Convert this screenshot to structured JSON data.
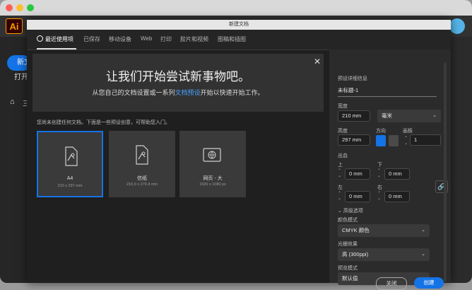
{
  "app": {
    "logo": "Ai"
  },
  "sidebar": {
    "new_label": "新文",
    "open_label": "打开",
    "home_label": "三"
  },
  "dialog": {
    "title": "新建文档",
    "tabs": [
      {
        "label": "最近使用项",
        "active": true
      },
      {
        "label": "已保存"
      },
      {
        "label": "移动设备"
      },
      {
        "label": "Web"
      },
      {
        "label": "打印"
      },
      {
        "label": "胶片和视频"
      },
      {
        "label": "图稿和插图"
      }
    ],
    "hero": {
      "title": "让我们开始尝试新事物吧。",
      "sub_before": "从您自己的文档设置或一系列",
      "sub_link": "文档预设",
      "sub_after": "开始以快速开始工作。"
    },
    "hint": "您尚未创建任何文档。下面是一些预设创意，可帮助您入门。",
    "presets": [
      {
        "name": "A4",
        "size": "210 x 297 mm",
        "selected": true
      },
      {
        "name": "信纸",
        "size": "215.9 x 279.4 mm"
      },
      {
        "name": "网页 - 大",
        "size": "1920 x 1080 px"
      }
    ]
  },
  "details": {
    "section_title": "预设详细信息",
    "doc_name": "未标题-1",
    "width_label": "宽度",
    "width_value": "210 mm",
    "unit_value": "毫米",
    "height_label": "高度",
    "height_value": "297 mm",
    "orientation_label": "方向",
    "artboards_label": "画板",
    "artboards_value": "1",
    "bleed_label": "出血",
    "top_label": "上",
    "top_value": "0 mm",
    "bottom_label": "下",
    "bottom_value": "0 mm",
    "left_label": "左",
    "left_value": "0 mm",
    "right_label": "右",
    "right_value": "0 mm",
    "advanced_label": "高级选项",
    "color_mode_label": "颜色模式",
    "color_mode_value": "CMYK 颜色",
    "raster_label": "光栅效果",
    "raster_value": "高 (300ppi)",
    "preview_label": "预览模式",
    "preview_value": "默认值"
  },
  "buttons": {
    "close": "关闭",
    "create": "创建"
  },
  "colors": {
    "accent": "#1473e6",
    "ai_orange": "#ff9a00"
  }
}
